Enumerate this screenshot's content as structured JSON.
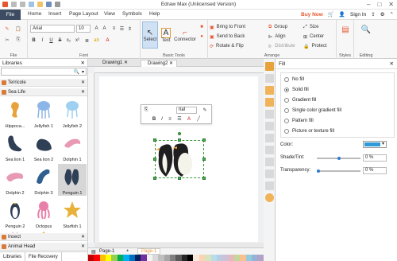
{
  "title": "Edraw Max (Unlicensed Version)",
  "menu": {
    "file": "File",
    "tabs": [
      "Home",
      "Insert",
      "Page Layout",
      "View",
      "Symbols",
      "Help"
    ],
    "buy": "Buy Now",
    "signin": "Sign In"
  },
  "ribbon": {
    "font_name": "Arial",
    "font_size": "10",
    "groups": {
      "file": "File",
      "font": "Font",
      "basic": "Basic Tools",
      "arrange": "Arrange",
      "styles": "Styles",
      "editing": "Editing"
    },
    "tools": {
      "select": "Select",
      "text": "Text",
      "connector": "Connector"
    },
    "arrange": {
      "front": "Bring to Front",
      "back": "Send to Back",
      "rotate": "Rotate & Flip",
      "group": "Group",
      "align": "Align",
      "distribute": "Distribute",
      "size": "Size",
      "center": "Center",
      "protect": "Protect"
    }
  },
  "libraries": {
    "title": "Libraries",
    "categories": [
      "Terricole",
      "Sea Life",
      "Insect",
      "Animal Head"
    ],
    "shapes": [
      "Hippoca...",
      "Jellyfish 1",
      "Jellyfish 2",
      "Sea lion 1",
      "Sea lion 2",
      "Dolphin 1",
      "Dolphin 2",
      "Dolphin 3",
      "Penguin 1",
      "Penguin 2",
      "Octopus",
      "Starfish 1"
    ],
    "bottom_tabs": [
      "Libraries",
      "File Recovery"
    ]
  },
  "doc": {
    "tabs": [
      "Drawing1",
      "Drawing2"
    ],
    "page_name": "Page-1",
    "page_tab": "Page-1",
    "font_mini": "rial"
  },
  "fill": {
    "title": "Fill",
    "options": [
      "No fill",
      "Solid fill",
      "Gradient fill",
      "Single color gradient fill",
      "Pattern fill",
      "Picture or texture fill"
    ],
    "selected": "Solid fill",
    "color_label": "Color:",
    "color": "#2e9bd6",
    "shade_label": "Shade/Tint:",
    "shade_value": "0 %",
    "transparency_label": "Transparency:",
    "transparency_value": "0 %"
  }
}
